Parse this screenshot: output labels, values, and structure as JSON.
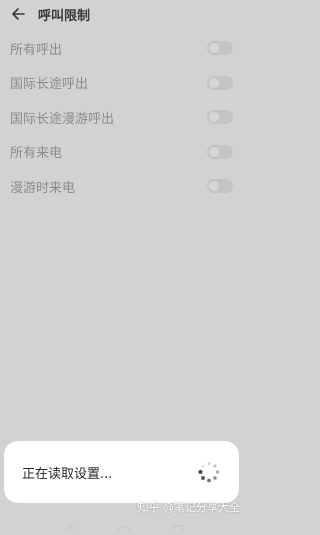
{
  "header": {
    "title": "呼叫限制",
    "back_icon": "back-arrow-icon"
  },
  "settings": {
    "items": [
      {
        "label": "所有呼出",
        "enabled": false
      },
      {
        "label": "国际长途呼出",
        "enabled": false
      },
      {
        "label": "国际长途漫游呼出",
        "enabled": false
      },
      {
        "label": "所有来电",
        "enabled": false
      },
      {
        "label": "漫游时来电",
        "enabled": false
      }
    ]
  },
  "dialog": {
    "text": "正在读取设置...",
    "spinner_icon": "loading-spinner-icon"
  },
  "watermark": {
    "text": "知乎 @笔记分享大全"
  },
  "colors": {
    "scrim": "#d2d2d2",
    "dialog_bg": "#ffffff",
    "label_muted": "#8c8c8c"
  }
}
